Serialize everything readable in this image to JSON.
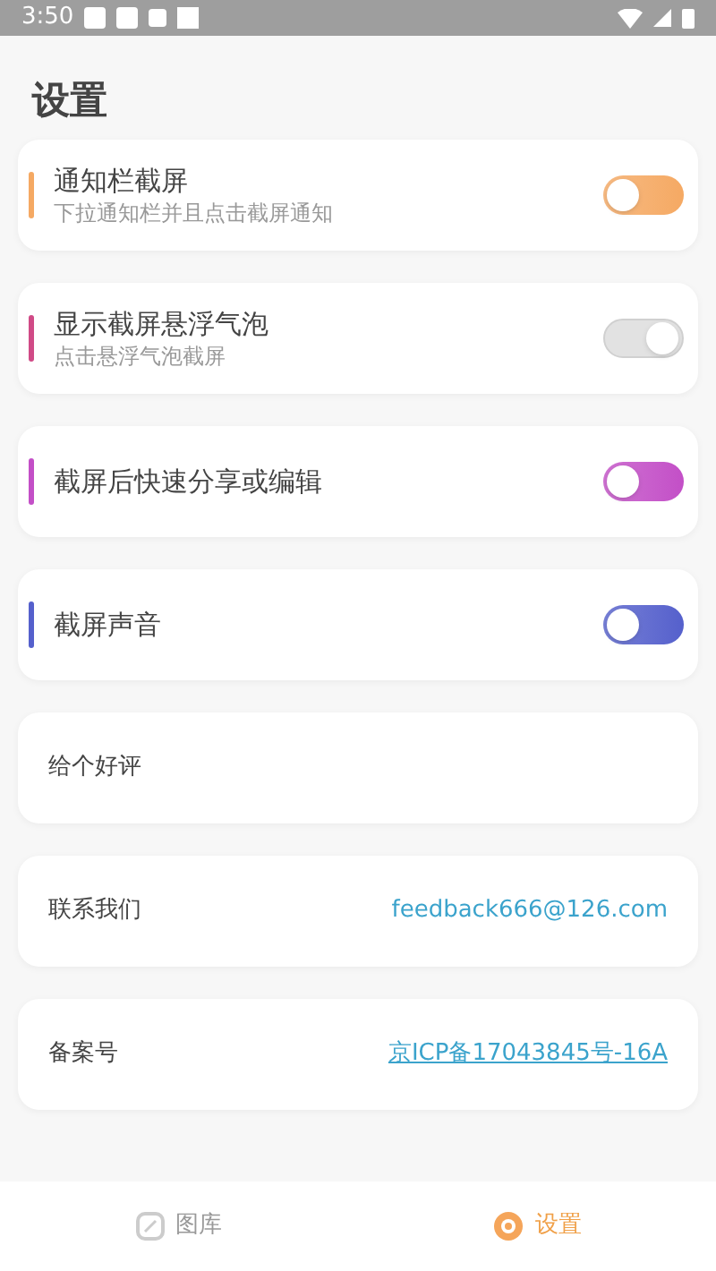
{
  "status_bar": {
    "time": "3:50"
  },
  "title": "设置",
  "settings": [
    {
      "title": "通知栏截屏",
      "subtitle": "下拉通知栏并且点击截屏通知",
      "on": false,
      "color": "#f5a963"
    },
    {
      "title": "显示截屏悬浮气泡",
      "subtitle": "点击悬浮气泡截屏",
      "on": true,
      "color": "#d04a86"
    },
    {
      "title": "截屏后快速分享或编辑",
      "on": false,
      "color": "#c34fc7"
    },
    {
      "title": "截屏声音",
      "on": false,
      "color": "#5560cc"
    }
  ],
  "links": [
    {
      "label": "给个好评"
    },
    {
      "label": "联系我们",
      "value": "feedback666@126.com",
      "underline": false
    },
    {
      "label": "备案号",
      "value": "京ICP备17043845号-16A",
      "underline": true
    }
  ],
  "bottom_nav": [
    {
      "label": "图库",
      "selected": false
    },
    {
      "label": "设置",
      "selected": true
    }
  ]
}
